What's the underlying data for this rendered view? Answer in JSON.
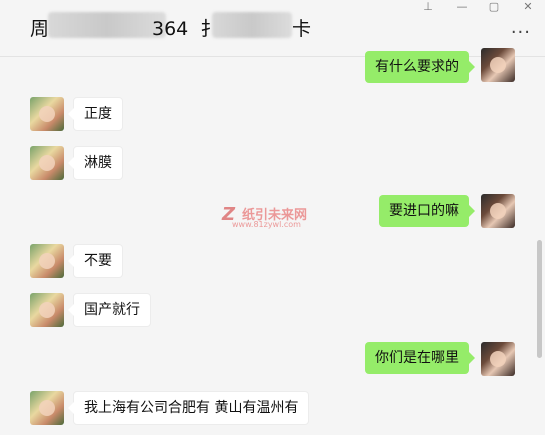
{
  "header": {
    "title_parts": [
      "周",
      "364  扌",
      "卡"
    ],
    "more_icon": "more-icon",
    "window_controls": [
      "pin-icon",
      "minimize-icon",
      "maximize-icon",
      "close-icon"
    ]
  },
  "messages": [
    {
      "side": "right",
      "text": "有什么要求的"
    },
    {
      "side": "left",
      "text": "正度"
    },
    {
      "side": "left",
      "text": "淋膜"
    },
    {
      "side": "right",
      "text": "要进口的嘛"
    },
    {
      "side": "left",
      "text": "不要"
    },
    {
      "side": "left",
      "text": "国产就行"
    },
    {
      "side": "right",
      "text": "你们是在哪里"
    },
    {
      "side": "left",
      "text": "我上海有公司合肥有 黄山有温州有"
    }
  ],
  "watermark": {
    "logo": "Z",
    "name": "纸引未来网",
    "url": "www.81zywl.com"
  }
}
